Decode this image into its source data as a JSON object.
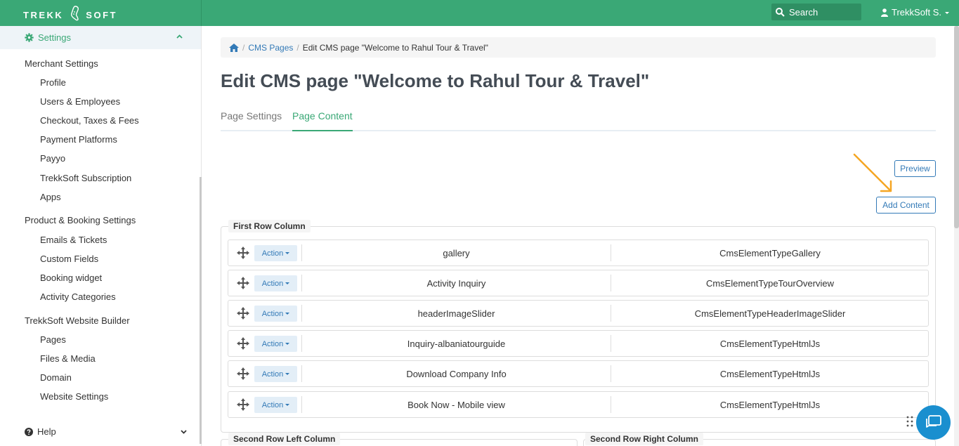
{
  "brand": {
    "left": "TREKK",
    "right": "SOFT"
  },
  "header": {
    "search_label": "Search",
    "user_label": "TrekkSoft S."
  },
  "sidebar": {
    "settings_label": "Settings",
    "groups": [
      {
        "label": "Merchant Settings",
        "items": [
          "Profile",
          "Users & Employees",
          "Checkout, Taxes & Fees",
          "Payment Platforms",
          "Payyo",
          "TrekkSoft Subscription",
          "Apps"
        ]
      },
      {
        "label": "Product & Booking Settings",
        "items": [
          "Emails & Tickets",
          "Custom Fields",
          "Booking widget",
          "Activity Categories"
        ]
      },
      {
        "label": "TrekkSoft Website Builder",
        "items": [
          "Pages",
          "Files & Media",
          "Domain",
          "Website Settings"
        ]
      }
    ],
    "help_label": "Help"
  },
  "breadcrumb": {
    "cms_pages": "CMS Pages",
    "current": "Edit CMS page \"Welcome to Rahul Tour & Travel\""
  },
  "page_title": "Edit CMS page \"Welcome to Rahul Tour & Travel\"",
  "tabs": {
    "page_settings": "Page Settings",
    "page_content": "Page Content"
  },
  "buttons": {
    "preview": "Preview",
    "add_content": "Add Content"
  },
  "sections": {
    "first_row": "First Row Column",
    "second_left": "Second Row Left Column",
    "second_right": "Second Row Right Column"
  },
  "rows": [
    {
      "action": "Action",
      "name": "gallery",
      "type": "CmsElementTypeGallery"
    },
    {
      "action": "Action",
      "name": "Activity Inquiry",
      "type": "CmsElementTypeTourOverview"
    },
    {
      "action": "Action",
      "name": "headerImageSlider",
      "type": "CmsElementTypeHeaderImageSlider"
    },
    {
      "action": "Action",
      "name": "Inquiry-albaniatourguide",
      "type": "CmsElementTypeHtmlJs"
    },
    {
      "action": "Action",
      "name": "Download Company Info",
      "type": "CmsElementTypeHtmlJs"
    },
    {
      "action": "Action",
      "name": "Book Now - Mobile view",
      "type": "CmsElementTypeHtmlJs"
    }
  ],
  "colors": {
    "brand_green": "#3aa876",
    "link_blue": "#337ab7",
    "chat_blue": "#1a8fcf",
    "arrow_orange": "#f5a623"
  }
}
